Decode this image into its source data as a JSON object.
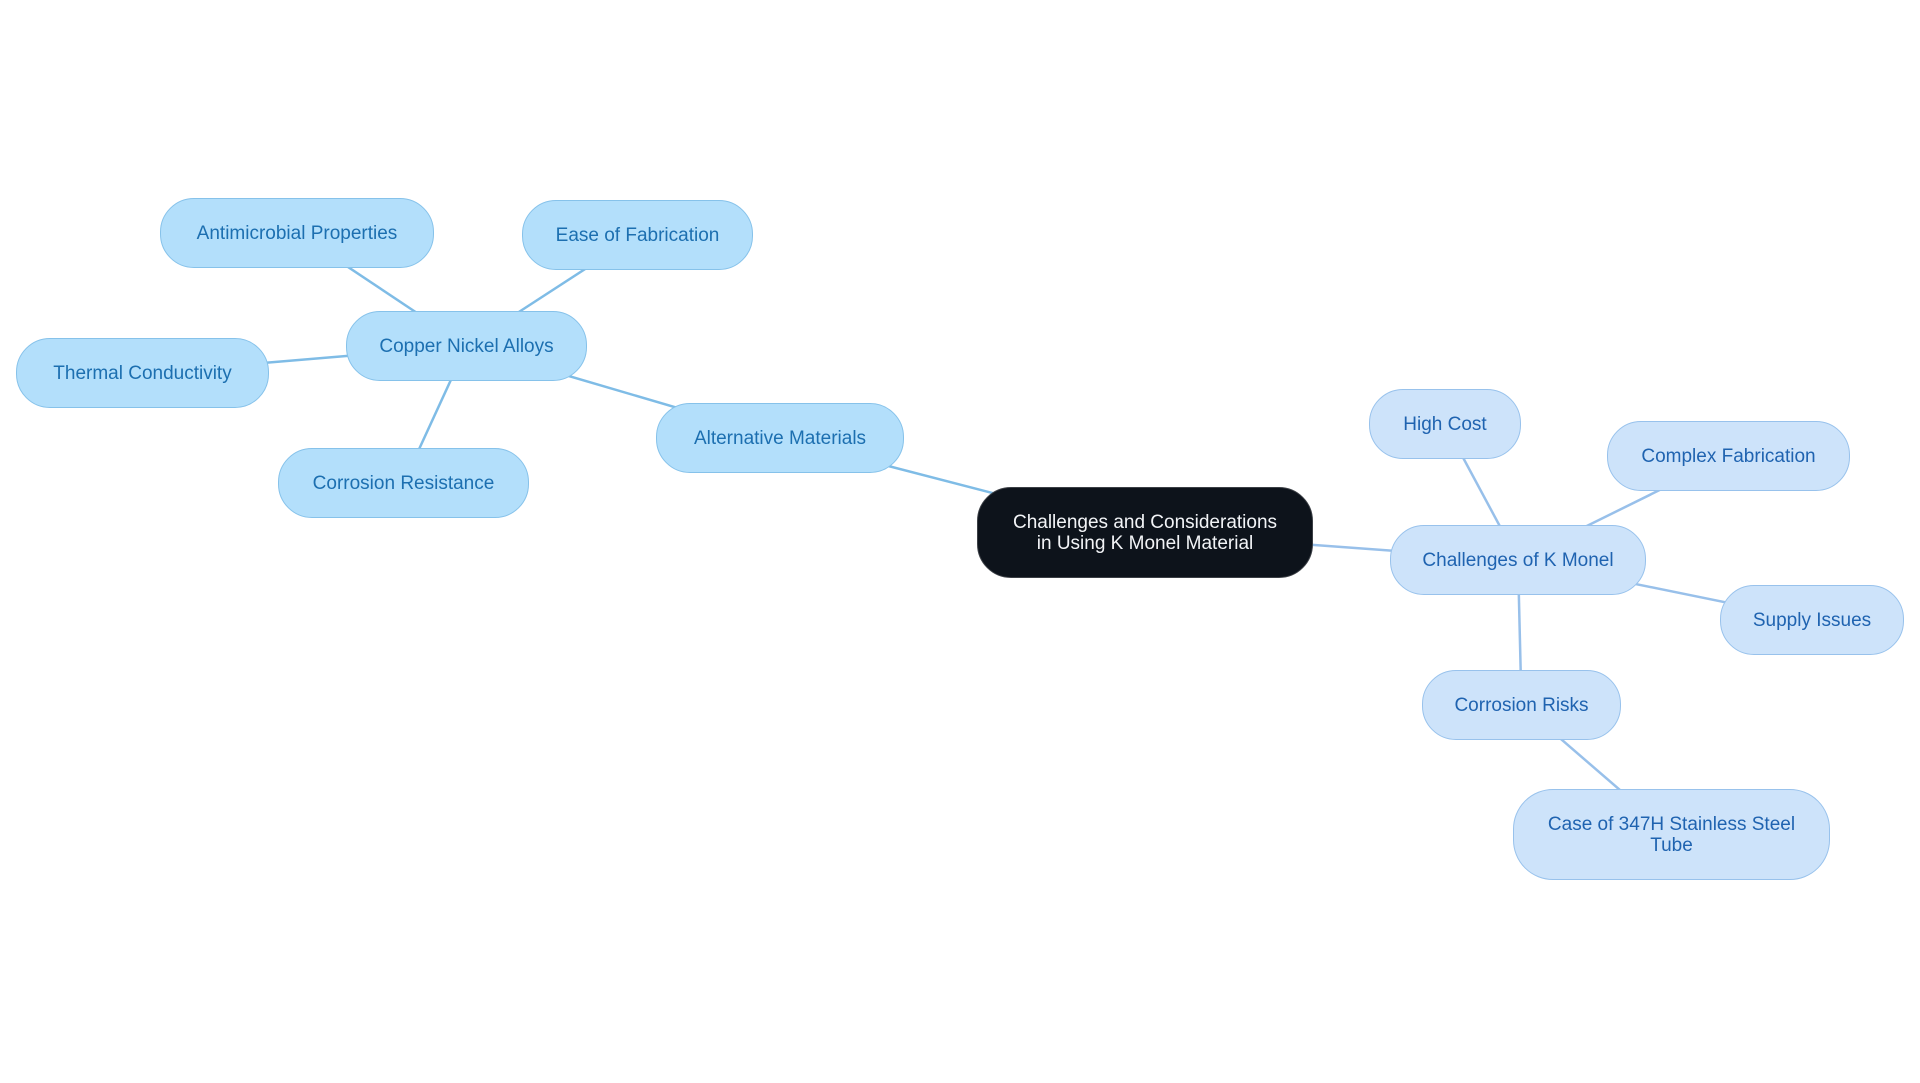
{
  "title": "Challenges and Considerations in Using K Monel Material",
  "colors": {
    "root_fill": "#0d131b",
    "alt_branch_fill": "#b3dffb",
    "alt_branch_text": "#1c6fb0",
    "alt_edge": "#7fbce6",
    "challenges_branch_fill": "#cde3fa",
    "challenges_branch_text": "#1f63b0",
    "challenges_edge": "#98c0ea"
  },
  "nodes": {
    "root": {
      "label": "Challenges and Considerations in Using K Monel Material",
      "lines": [
        "Challenges and Considerations",
        "in Using K Monel Material"
      ]
    },
    "alternative_materials": {
      "label": "Alternative Materials"
    },
    "copper_nickel_alloys": {
      "label": "Copper Nickel Alloys"
    },
    "antimicrobial_properties": {
      "label": "Antimicrobial Properties"
    },
    "ease_of_fabrication": {
      "label": "Ease of Fabrication"
    },
    "thermal_conductivity": {
      "label": "Thermal Conductivity"
    },
    "corrosion_resistance": {
      "label": "Corrosion Resistance"
    },
    "challenges_of_k_monel": {
      "label": "Challenges of K Monel"
    },
    "high_cost": {
      "label": "High Cost"
    },
    "complex_fabrication": {
      "label": "Complex Fabrication"
    },
    "supply_issues": {
      "label": "Supply Issues"
    },
    "corrosion_risks": {
      "label": "Corrosion Risks"
    },
    "case_347h": {
      "label": "Case of 347H Stainless Steel Tube",
      "lines": [
        "Case of 347H Stainless Steel",
        "Tube"
      ]
    }
  },
  "edges": [
    {
      "from": "root",
      "to": "alternative_materials",
      "branch": "alt"
    },
    {
      "from": "alternative_materials",
      "to": "copper_nickel_alloys",
      "branch": "alt"
    },
    {
      "from": "copper_nickel_alloys",
      "to": "antimicrobial_properties",
      "branch": "alt"
    },
    {
      "from": "copper_nickel_alloys",
      "to": "ease_of_fabrication",
      "branch": "alt"
    },
    {
      "from": "copper_nickel_alloys",
      "to": "thermal_conductivity",
      "branch": "alt"
    },
    {
      "from": "copper_nickel_alloys",
      "to": "corrosion_resistance",
      "branch": "alt"
    },
    {
      "from": "root",
      "to": "challenges_of_k_monel",
      "branch": "chal"
    },
    {
      "from": "challenges_of_k_monel",
      "to": "high_cost",
      "branch": "chal"
    },
    {
      "from": "challenges_of_k_monel",
      "to": "complex_fabrication",
      "branch": "chal"
    },
    {
      "from": "challenges_of_k_monel",
      "to": "supply_issues",
      "branch": "chal"
    },
    {
      "from": "challenges_of_k_monel",
      "to": "corrosion_risks",
      "branch": "chal"
    },
    {
      "from": "corrosion_risks",
      "to": "case_347h",
      "branch": "chal"
    }
  ]
}
